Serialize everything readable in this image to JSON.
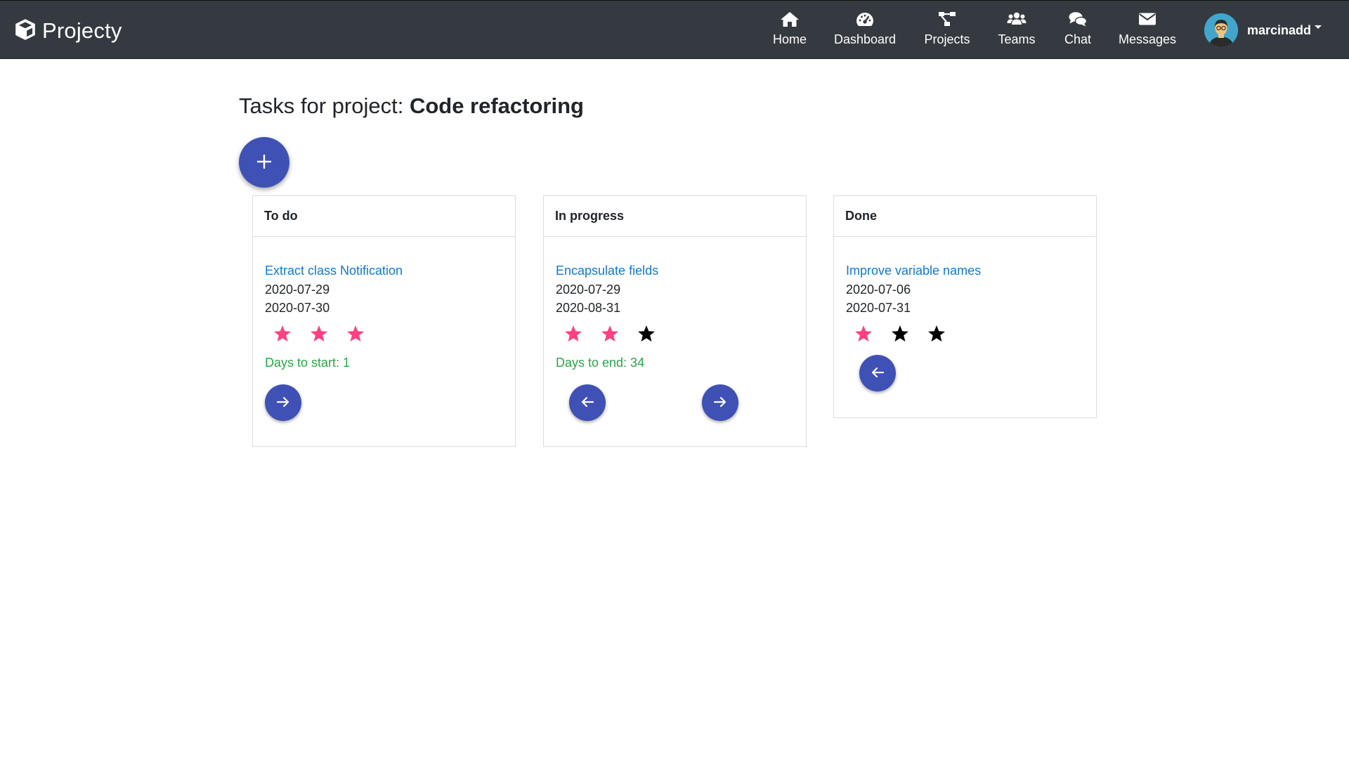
{
  "brand": {
    "name": "Projecty",
    "icon": "cube-icon"
  },
  "nav": {
    "items": [
      {
        "label": "Home",
        "icon": "home-icon"
      },
      {
        "label": "Dashboard",
        "icon": "tachometer-icon"
      },
      {
        "label": "Projects",
        "icon": "project-diagram-icon"
      },
      {
        "label": "Teams",
        "icon": "users-icon"
      },
      {
        "label": "Chat",
        "icon": "comments-icon"
      },
      {
        "label": "Messages",
        "icon": "envelope-icon"
      }
    ],
    "user": {
      "name": "marcinadd",
      "avatar": "avatar"
    }
  },
  "page": {
    "title_prefix": "Tasks for project:",
    "project_name": "Code refactoring",
    "add_button_icon": "plus-icon"
  },
  "columns": [
    {
      "title": "To do",
      "task": {
        "title": "Extract class Notification",
        "start_date": "2020-07-29",
        "end_date": "2020-07-30",
        "priority": 3,
        "max_priority": 3,
        "days_text": "Days to start: 1"
      }
    },
    {
      "title": "In progress",
      "task": {
        "title": "Encapsulate fields",
        "start_date": "2020-07-29",
        "end_date": "2020-08-31",
        "priority": 2,
        "max_priority": 3,
        "days_text": "Days to end: 34"
      }
    },
    {
      "title": "Done",
      "task": {
        "title": "Improve variable names",
        "start_date": "2020-07-06",
        "end_date": "2020-07-31",
        "priority": 1,
        "max_priority": 3
      }
    }
  ],
  "colors": {
    "navbar": "#343a40",
    "accent": "#3f51b5",
    "link": "#0e7ad6",
    "star_active": "#ff4081",
    "star_inactive": "#000000",
    "days_text": "#28a745"
  }
}
